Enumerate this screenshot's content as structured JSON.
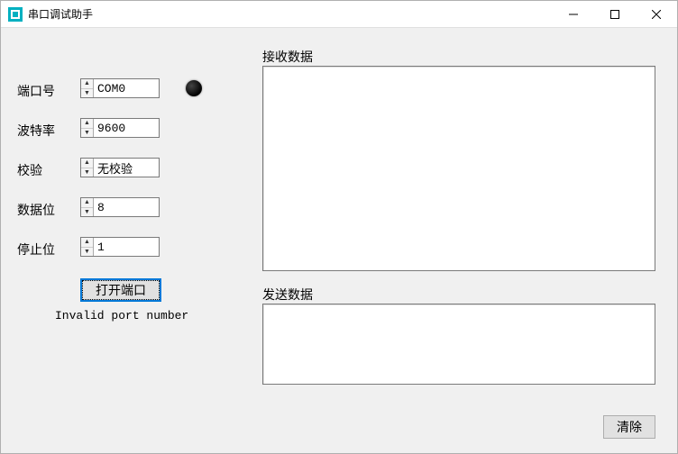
{
  "window": {
    "title": "串口调试助手"
  },
  "labels": {
    "port": "端口号",
    "baud": "波特率",
    "parity": "校验",
    "databits": "数据位",
    "stopbits": "停止位",
    "rx": "接收数据",
    "tx": "发送数据"
  },
  "fields": {
    "port": "COM0",
    "baud": "9600",
    "parity": "无校验",
    "databits": "8",
    "stopbits": "1"
  },
  "buttons": {
    "open_port": "打开端口",
    "clear": "清除"
  },
  "status": {
    "message": "Invalid port number"
  },
  "areas": {
    "rx_text": "",
    "tx_text": ""
  }
}
